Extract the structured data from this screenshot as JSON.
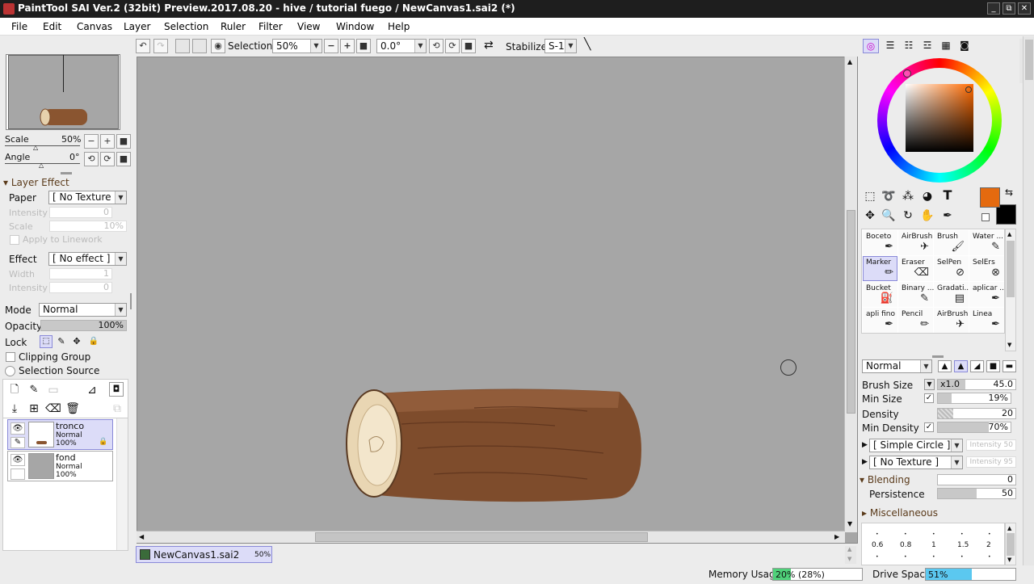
{
  "window": {
    "title": "PaintTool SAI Ver.2 (32bit) Preview.2017.08.20 - hive / tutorial fuego / NewCanvas1.sai2 (*)",
    "min": "_",
    "restore": "⧉",
    "close": "✕"
  },
  "menu": [
    "File",
    "Edit",
    "Canvas",
    "Layer",
    "Selection",
    "Ruler",
    "Filter",
    "View",
    "Window",
    "Help"
  ],
  "toolbar": {
    "selection_label": "Selection",
    "zoom_value": "50%",
    "angle_value": "0.0°",
    "stabilizer_label": "Stabilizer",
    "stabilizer_value": "S-1"
  },
  "navigator": {
    "scale_label": "Scale",
    "scale_value": "50%",
    "angle_label": "Angle",
    "angle_value": "0°"
  },
  "layer_effect": {
    "header": "Layer Effect",
    "paper_label": "Paper",
    "paper_value": "[ No Texture ]",
    "intensity_label": "Intensity",
    "intensity_value": "0",
    "scale_label": "Scale",
    "scale_value": "10%",
    "apply_linework": "Apply to Linework",
    "effect_label": "Effect",
    "effect_value": "[ No effect ]",
    "width_label": "Width",
    "width_value": "1",
    "intensity2_label": "Intensity",
    "intensity2_value": "0"
  },
  "layer_props": {
    "mode_label": "Mode",
    "mode_value": "Normal",
    "opacity_label": "Opacity",
    "opacity_value": "100%",
    "opacity_fraction": 1.0,
    "lock_label": "Lock",
    "clipping_group": "Clipping Group",
    "selection_source": "Selection Source"
  },
  "layers": [
    {
      "name": "tronco",
      "mode": "Normal",
      "opacity": "100%",
      "selected": true
    },
    {
      "name": "fond",
      "mode": "Normal",
      "opacity": "100%",
      "selected": false
    }
  ],
  "document_tab": {
    "name": "NewCanvas1.sai2",
    "zoom": "50%"
  },
  "tools": [
    {
      "name": "Boceto",
      "icon": "pen-icon",
      "selected": false
    },
    {
      "name": "AirBrush",
      "icon": "airbrush-icon",
      "selected": false
    },
    {
      "name": "Brush",
      "icon": "brush-icon",
      "selected": false
    },
    {
      "name": "Water ...",
      "icon": "water-brush-icon",
      "selected": false
    },
    {
      "name": "Marker",
      "icon": "marker-icon",
      "selected": true
    },
    {
      "name": "Eraser",
      "icon": "eraser-icon",
      "selected": false
    },
    {
      "name": "SelPen",
      "icon": "selpen-icon",
      "selected": false
    },
    {
      "name": "SelErs",
      "icon": "selers-icon",
      "selected": false
    },
    {
      "name": "Bucket",
      "icon": "bucket-icon",
      "selected": false
    },
    {
      "name": "Binary ...",
      "icon": "binary-pen-icon",
      "selected": false
    },
    {
      "name": "Gradati...",
      "icon": "gradation-icon",
      "selected": false
    },
    {
      "name": "aplicar ...",
      "icon": "pen-icon",
      "selected": false
    },
    {
      "name": "apli fino",
      "icon": "pen-icon",
      "selected": false
    },
    {
      "name": "Pencil",
      "icon": "pencil-icon",
      "selected": false
    },
    {
      "name": "AirBrush",
      "icon": "airbrush-icon",
      "selected": false
    },
    {
      "name": "Linea",
      "icon": "pen-icon",
      "selected": false
    }
  ],
  "brush": {
    "blend_mode": "Normal",
    "size_label": "Brush Size",
    "size_mult": "x1.0",
    "size_value": "45.0",
    "min_size_label": "Min Size",
    "min_size_value": "19%",
    "min_size_fraction": 0.19,
    "density_label": "Density",
    "density_value": "20",
    "min_density_label": "Min Density",
    "min_density_value": "70%",
    "min_density_fraction": 0.7,
    "shape_value": "[ Simple Circle ]",
    "shape_intensity": "Intensity 50",
    "texture_value": "[ No Texture ]",
    "texture_intensity": "Intensity 95",
    "blending_label": "Blending",
    "blending_value": "0",
    "persistence_label": "Persistence",
    "persistence_value": "50",
    "persistence_fraction": 0.5,
    "misc_label": "Miscellaneous",
    "size_presets": [
      "0.6",
      "0.8",
      "1",
      "1.5",
      "2"
    ]
  },
  "colors": {
    "foreground": "#e46a0f",
    "background": "#000000",
    "accent": "#8a8ad8"
  },
  "status": {
    "memory_label": "Memory Usage",
    "memory_value": "20% (28%)",
    "memory_fraction": 0.2,
    "drive_label": "Drive Space",
    "drive_value": "51%",
    "drive_fraction": 0.51
  }
}
